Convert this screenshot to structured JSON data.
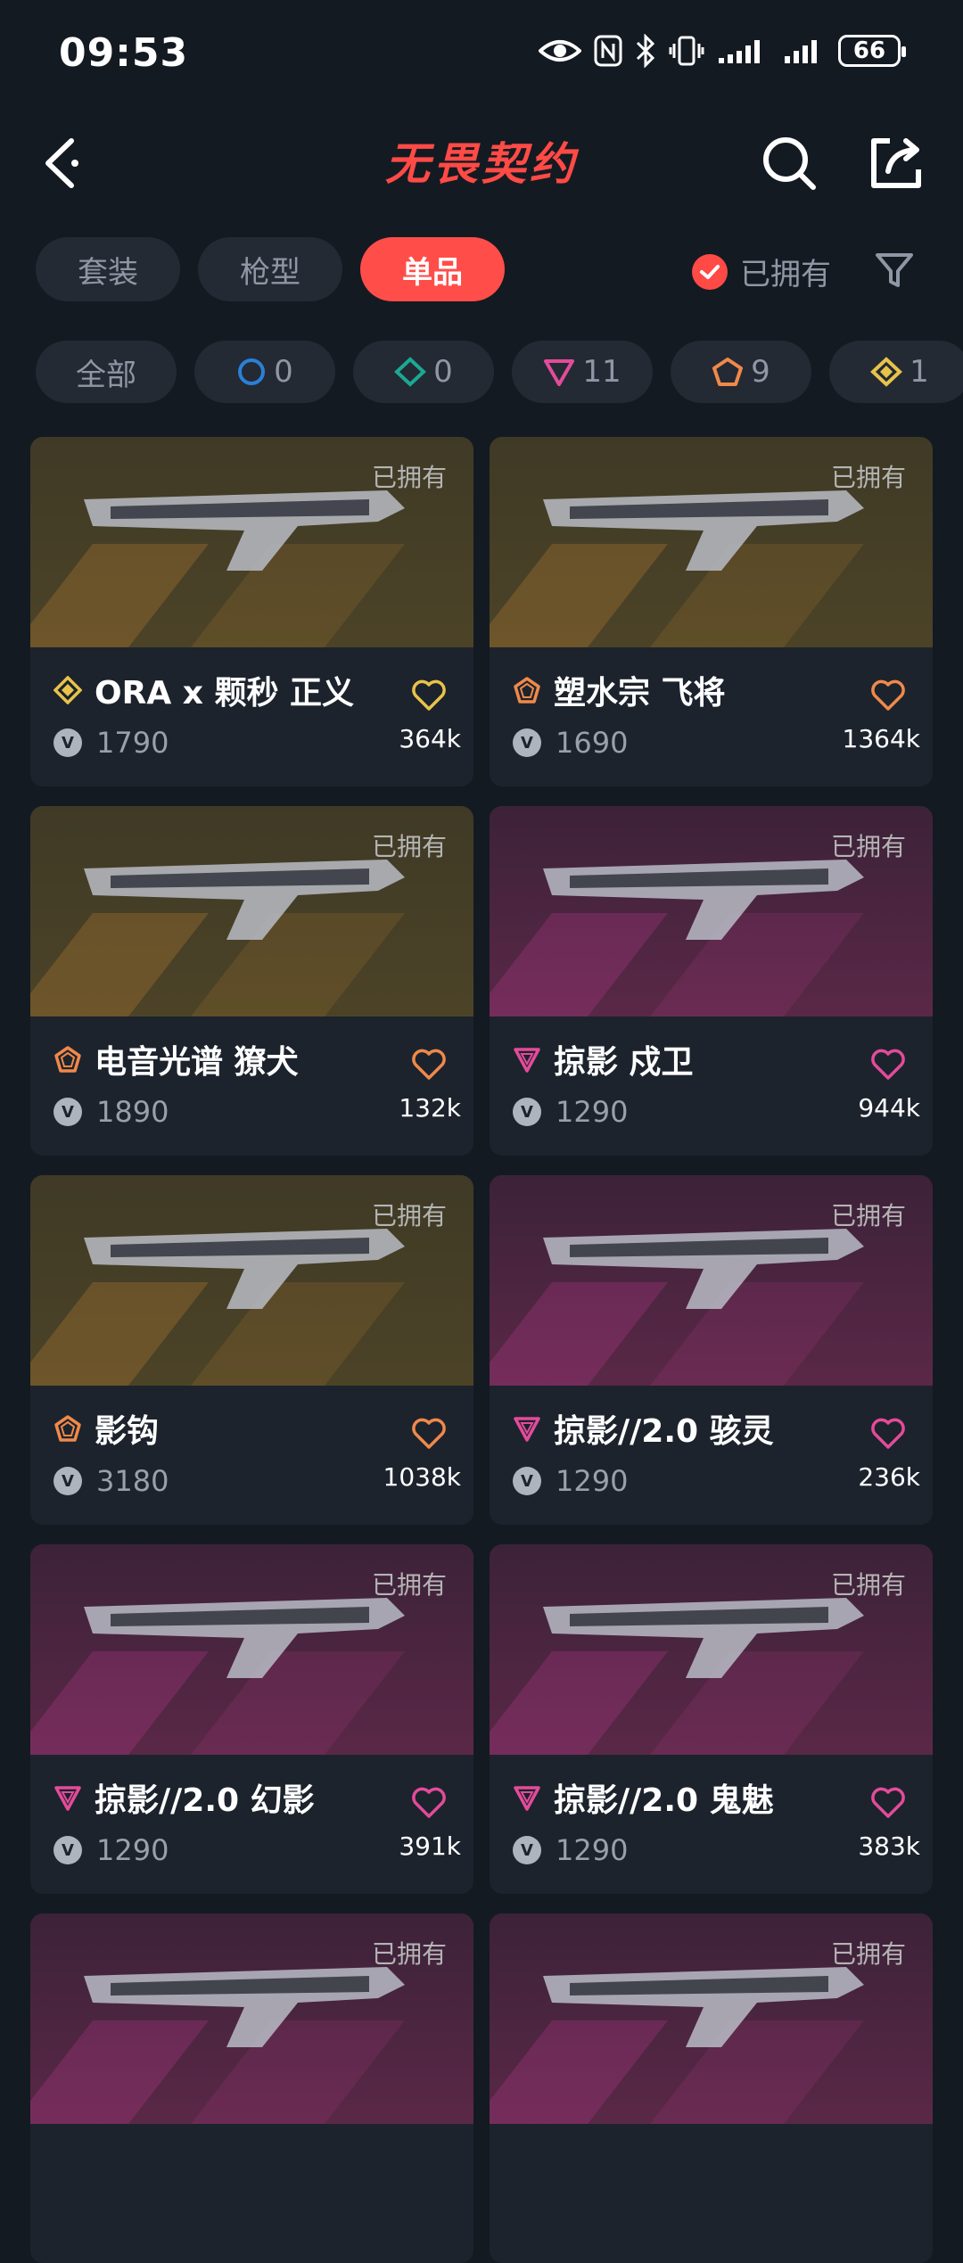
{
  "status": {
    "time": "09:53",
    "battery": "66"
  },
  "header": {
    "title": "无畏契约"
  },
  "tabs": [
    {
      "label": "套装",
      "active": false
    },
    {
      "label": "枪型",
      "active": false
    },
    {
      "label": "单品",
      "active": true
    }
  ],
  "owned_filter_label": "已拥有",
  "tiers": [
    {
      "label": "全部",
      "count": ""
    },
    {
      "icon": "select-tier-icon",
      "color": "#2b7fd6",
      "count": "0"
    },
    {
      "icon": "deluxe-tier-icon",
      "color": "#1ca892",
      "count": "0"
    },
    {
      "icon": "premium-tier-icon",
      "color": "#e44b9a",
      "count": "11"
    },
    {
      "icon": "exclusive-tier-icon",
      "color": "#f0894a",
      "count": "9"
    },
    {
      "icon": "ultra-tier-icon",
      "color": "#e8c34a",
      "count": "1"
    }
  ],
  "cards": [
    {
      "name": "ORA x 颗秒 正义",
      "price": "1790",
      "likes": "364k",
      "owned": "已拥有",
      "tier": "ultra",
      "tier_color": "#e8c34a",
      "heart_color": "#e8c34a",
      "bg": "gold"
    },
    {
      "name": "塑水宗 飞将",
      "price": "1690",
      "likes": "1364k",
      "owned": "已拥有",
      "tier": "exclusive",
      "tier_color": "#f0894a",
      "heart_color": "#f0894a",
      "bg": "gold"
    },
    {
      "name": "电音光谱 獠犬",
      "price": "1890",
      "likes": "132k",
      "owned": "已拥有",
      "tier": "exclusive",
      "tier_color": "#f0894a",
      "heart_color": "#f0894a",
      "bg": "gold"
    },
    {
      "name": "掠影 戍卫",
      "price": "1290",
      "likes": "944k",
      "owned": "已拥有",
      "tier": "premium",
      "tier_color": "#e44b9a",
      "heart_color": "#e44b9a",
      "bg": "purple"
    },
    {
      "name": "影钩",
      "price": "3180",
      "likes": "1038k",
      "owned": "已拥有",
      "tier": "exclusive",
      "tier_color": "#f0894a",
      "heart_color": "#f0894a",
      "bg": "gold"
    },
    {
      "name": "掠影//2.0 骇灵",
      "price": "1290",
      "likes": "236k",
      "owned": "已拥有",
      "tier": "premium",
      "tier_color": "#e44b9a",
      "heart_color": "#e44b9a",
      "bg": "purple"
    },
    {
      "name": "掠影//2.0 幻影",
      "price": "1290",
      "likes": "391k",
      "owned": "已拥有",
      "tier": "premium",
      "tier_color": "#e44b9a",
      "heart_color": "#e44b9a",
      "bg": "purple"
    },
    {
      "name": "掠影//2.0 鬼魅",
      "price": "1290",
      "likes": "383k",
      "owned": "已拥有",
      "tier": "premium",
      "tier_color": "#e44b9a",
      "heart_color": "#e44b9a",
      "bg": "purple"
    },
    {
      "name": "",
      "price": "",
      "likes": "",
      "owned": "已拥有",
      "tier": "premium",
      "tier_color": "#e44b9a",
      "heart_color": "#e44b9a",
      "bg": "purple"
    },
    {
      "name": "",
      "price": "",
      "likes": "",
      "owned": "已拥有",
      "tier": "premium",
      "tier_color": "#e44b9a",
      "heart_color": "#e44b9a",
      "bg": "purple"
    }
  ]
}
